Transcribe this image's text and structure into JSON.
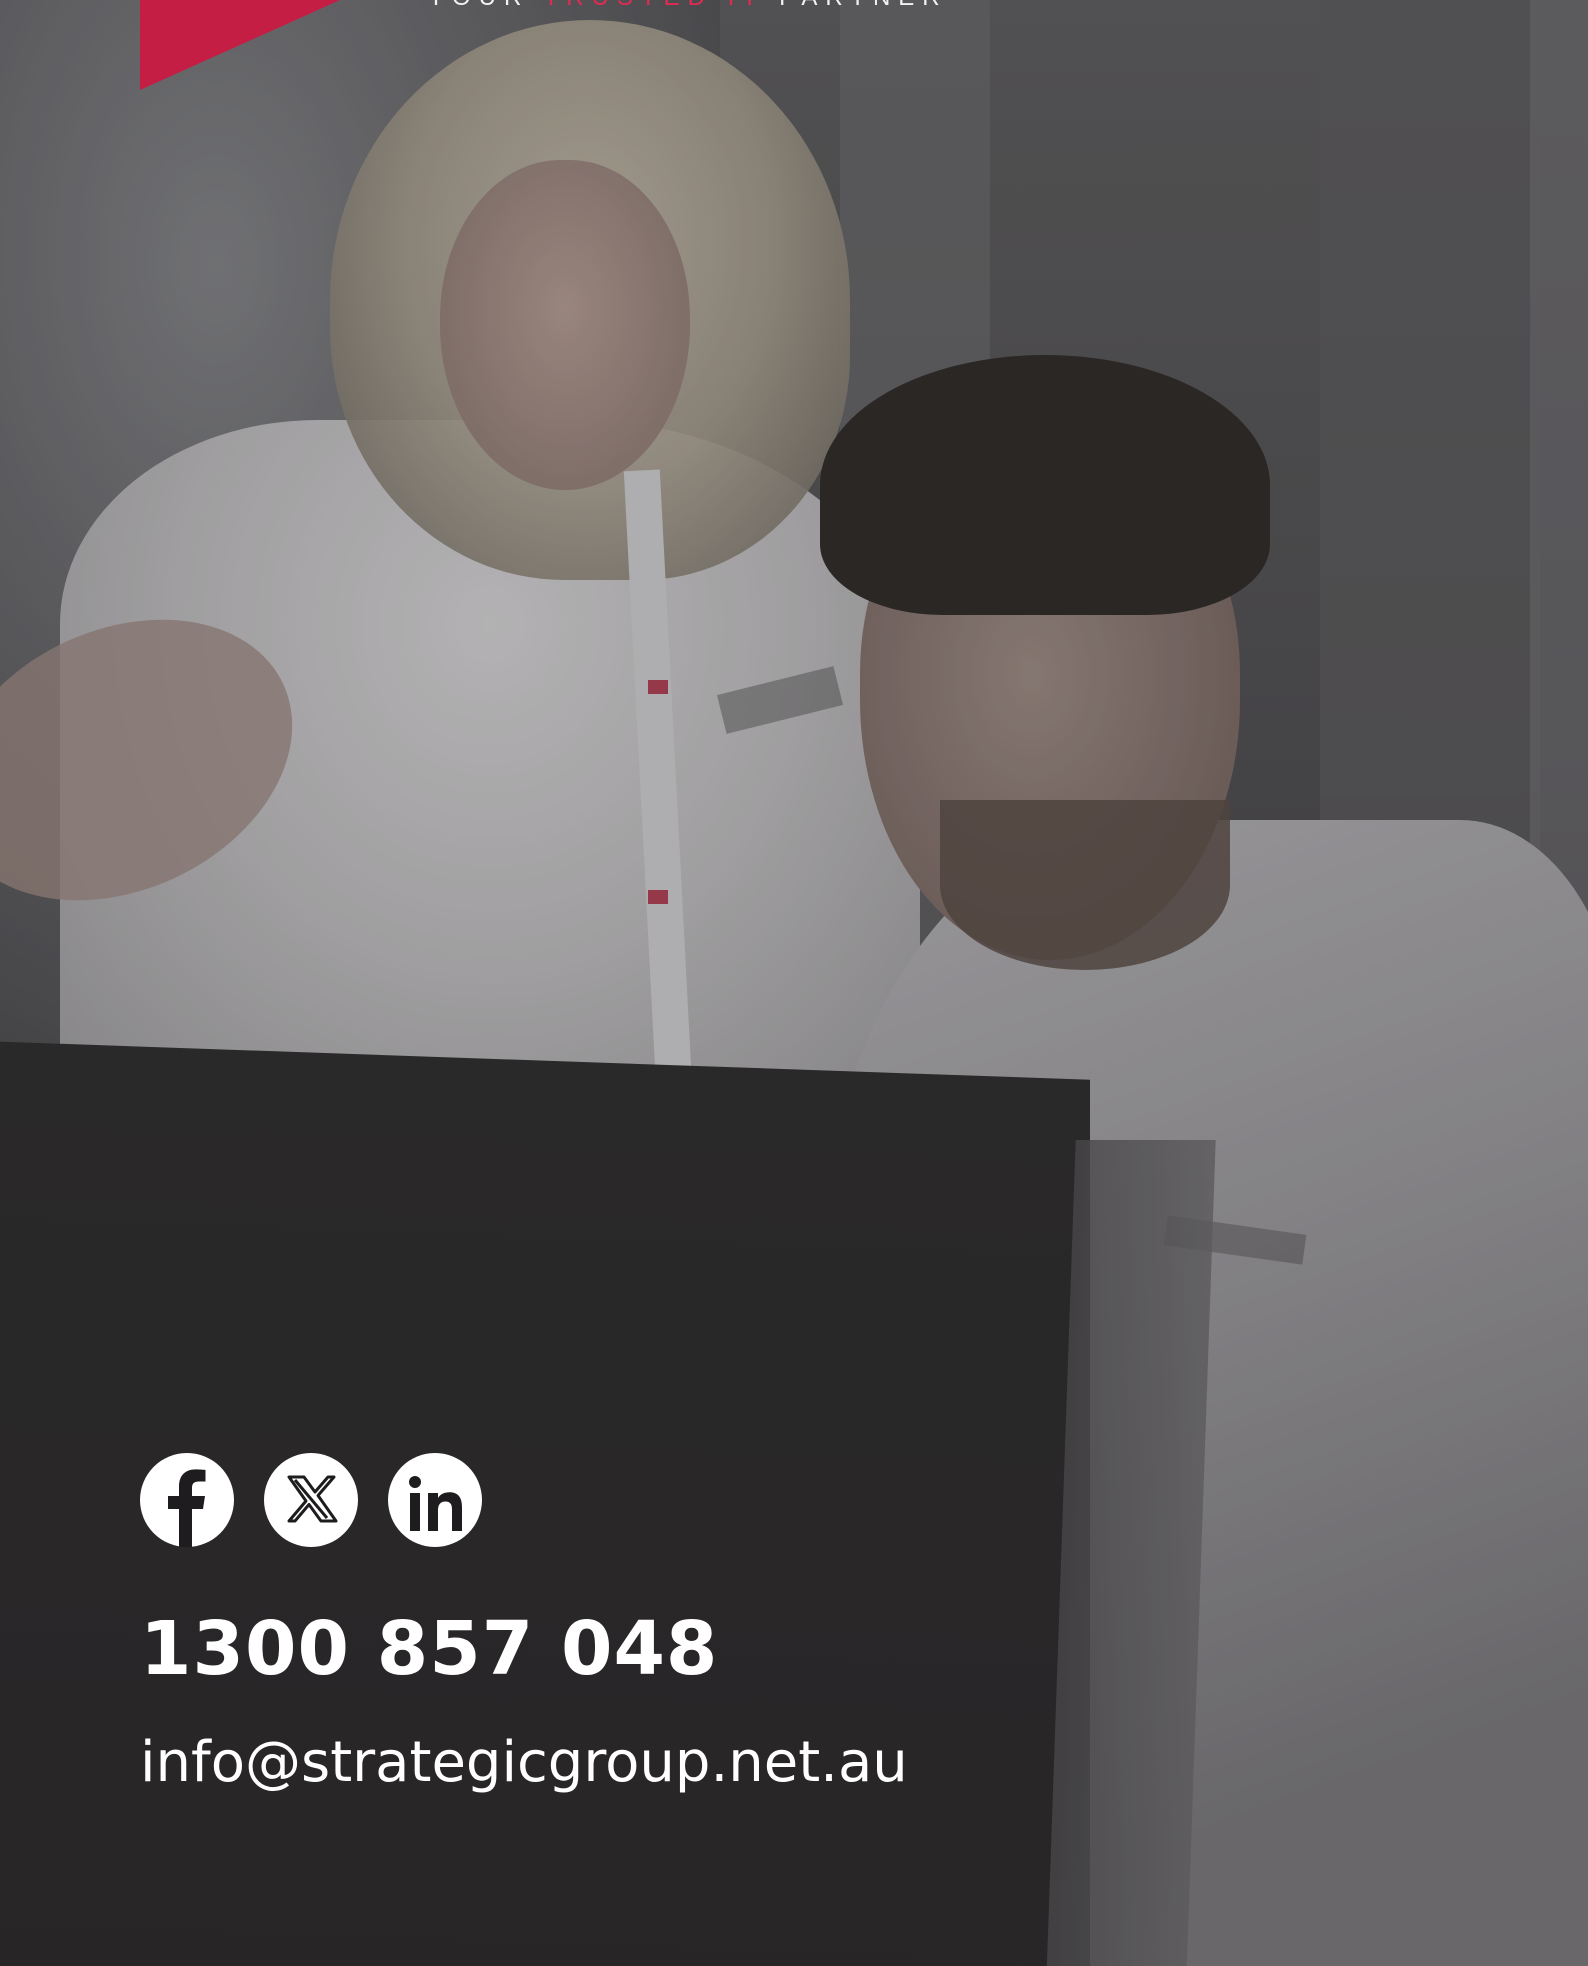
{
  "header": {
    "tagline_part1": "YOUR ",
    "tagline_part2": "TRUSTED IT",
    "tagline_part3": " PARTNER"
  },
  "social": {
    "items": [
      {
        "name": "facebook",
        "icon": "facebook-icon"
      },
      {
        "name": "x",
        "icon": "x-icon"
      },
      {
        "name": "linkedin",
        "icon": "linkedin-icon"
      }
    ]
  },
  "contact": {
    "phone": "1300 857 048",
    "email": "info@strategicgroup.net.au"
  },
  "colors": {
    "brand_red": "#e32a52",
    "text_white": "#ffffff"
  }
}
